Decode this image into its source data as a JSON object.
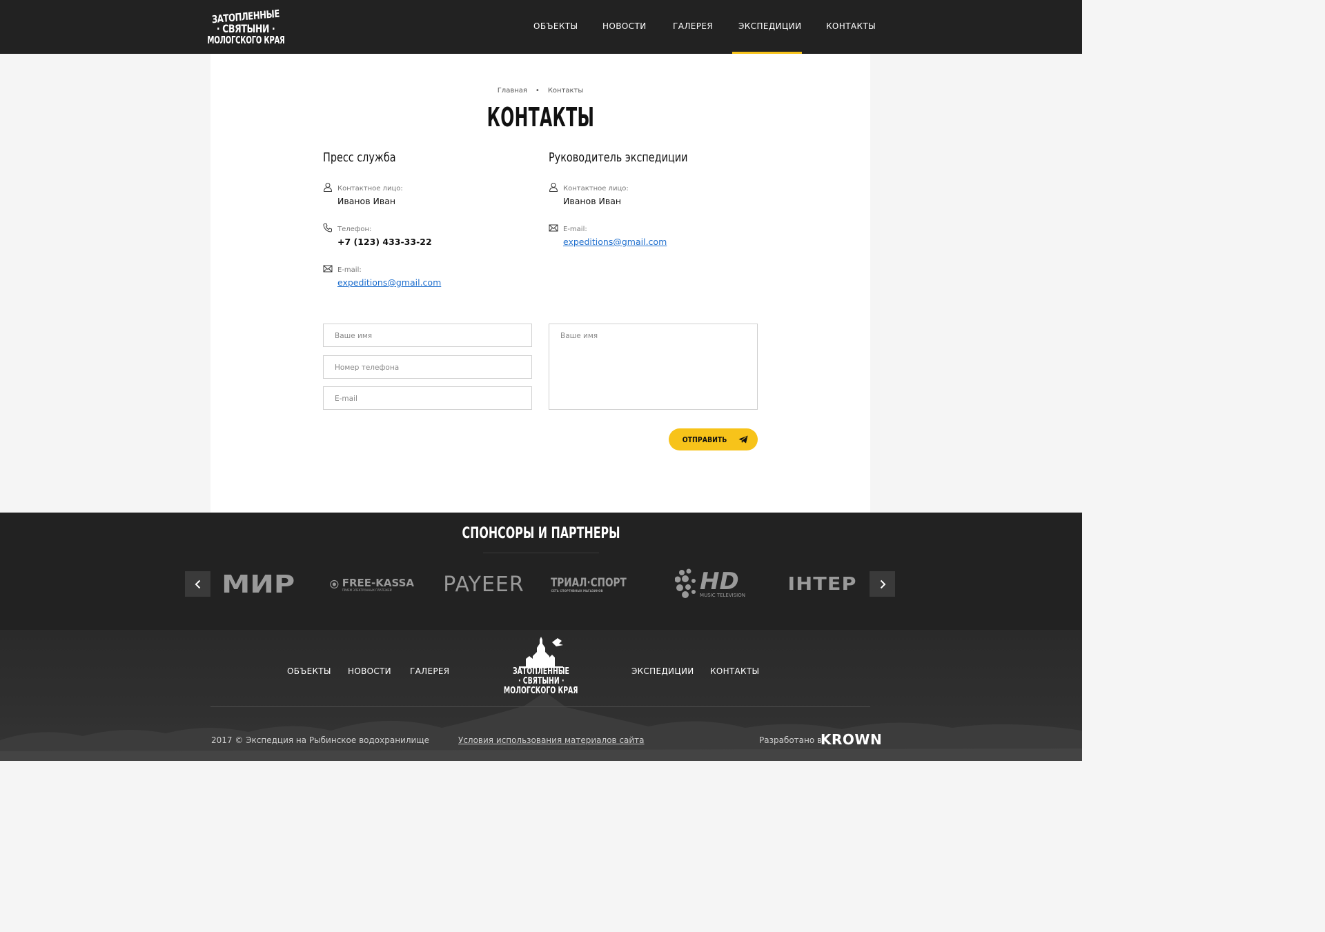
{
  "header": {
    "logo_lines": [
      "ЗАТОПЛЕННЫЕ",
      "· СВЯТЫНИ ·",
      "МОЛОГСКОГО КРАЯ"
    ],
    "nav": [
      "ОБЪЕКТЫ",
      "НОВОСТИ",
      "ГАЛЕРЕЯ",
      "ЭКСПЕДИЦИИ",
      "КОНТАКТЫ"
    ],
    "active_nav": "ЭКСПЕДИЦИИ"
  },
  "breadcrumb": [
    "Главная",
    "Контакты"
  ],
  "page_title": "КОНТАКТЫ",
  "contacts": [
    {
      "heading": "Пресс служба",
      "rows": [
        {
          "icon": "user-icon",
          "label": "Контактное лицо:",
          "value": "Иванов Иван"
        },
        {
          "icon": "phone-icon",
          "label": "Телефон:",
          "value": "+7 (123) 433-33-22"
        },
        {
          "icon": "envelope-icon",
          "label": "E-mail:",
          "value": "expeditions@gmail.com"
        }
      ]
    },
    {
      "heading": "Руководитель экспедиции",
      "rows": [
        {
          "icon": "user-icon",
          "label": "Контактное лицо:",
          "value": "Иванов Иван"
        },
        {
          "icon": "envelope-icon",
          "label": "E-mail:",
          "value": "expeditions@gmail.com"
        }
      ]
    }
  ],
  "form": {
    "name_placeholder": "Ваше имя",
    "phone_placeholder": "Номер телефона",
    "email_placeholder": "E-mail",
    "message_placeholder": "Ваше имя",
    "submit_label": "ОТПРАВИТЬ"
  },
  "sponsors": {
    "title": "СПОНСОРЫ И ПАРТНЕРЫ",
    "logos": [
      "МИР",
      "FREE-KASSA",
      "PAYEER",
      "ТРИАЛ·СПОРТ",
      "HD",
      "ІНТЕР"
    ],
    "logo_sublabels": {
      "FREE-KASSA": "ПРИЕМ ЭЛЕКТРОННЫХ ПЛАТЕЖЕЙ",
      "ТРИАЛ·СПОРТ": "СЕТЬ СПОРТИВНЫХ МАГАЗИНОВ",
      "HD": "MUSIC TELEVISION"
    }
  },
  "footer": {
    "nav_left": [
      "ОБЪЕКТЫ",
      "НОВОСТИ",
      "ГАЛЕРЕЯ"
    ],
    "nav_right": [
      "ЭКСПЕДИЦИИ",
      "КОНТАКТЫ"
    ],
    "logo_lines": [
      "ЗАТОПЛЕННЫЕ",
      "· СВЯТЫНИ ·",
      "МОЛОГСКОГО КРАЯ"
    ],
    "copyright": "2017 © Экспедция на Рыбинское водохранилище",
    "terms": "Условия использования материалов сайта",
    "developed_by": "Разработано в",
    "developer": "KROWN"
  },
  "colors": {
    "accent": "#f7c31a",
    "dark": "#222222",
    "link": "#1f6fce"
  }
}
